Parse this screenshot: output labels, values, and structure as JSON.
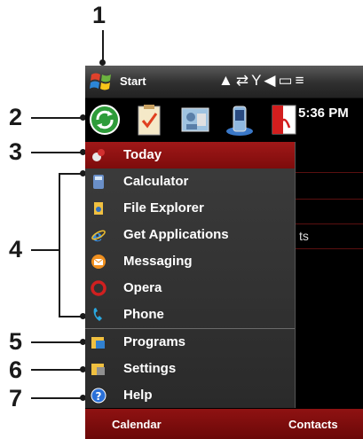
{
  "callouts": [
    "1",
    "2",
    "3",
    "4",
    "5",
    "6",
    "7"
  ],
  "status_bar": {
    "start_label": "Start",
    "icons": [
      "signal-icon",
      "sync-icon",
      "network-icon",
      "volume-icon",
      "battery-icon",
      "more-icon"
    ]
  },
  "recent_programs": {
    "time": "5:36 PM",
    "icons": [
      "refresh-icon",
      "tasks-icon",
      "contacts-icon",
      "device-icon",
      "pdf-icon"
    ]
  },
  "menu": {
    "items": [
      {
        "label": "Today",
        "icon": "today-icon",
        "selected": true
      },
      {
        "label": "Calculator",
        "icon": "calculator-icon"
      },
      {
        "label": "File Explorer",
        "icon": "file-explorer-icon"
      },
      {
        "label": "Get Applications",
        "icon": "ie-icon"
      },
      {
        "label": "Messaging",
        "icon": "messaging-icon"
      },
      {
        "label": "Opera",
        "icon": "opera-icon"
      },
      {
        "label": "Phone",
        "icon": "phone-icon"
      },
      {
        "label": "Programs",
        "icon": "programs-folder-icon"
      },
      {
        "label": "Settings",
        "icon": "settings-folder-icon"
      },
      {
        "label": "Help",
        "icon": "help-icon"
      }
    ]
  },
  "today_fragment": "ts",
  "softkeys": {
    "left": "Calendar",
    "right": "Contacts"
  },
  "colors": {
    "accent": "#8f1212",
    "menu_bg": "#333333"
  }
}
